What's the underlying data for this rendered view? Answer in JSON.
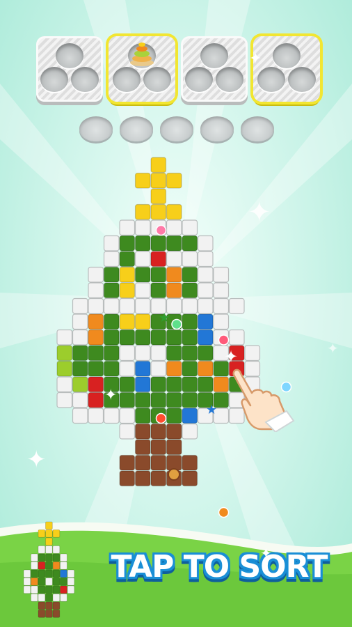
{
  "banner": {
    "text": "TAP TO SORT"
  },
  "colors": {
    "green": "#3e8a1f",
    "green_dark": "#2f6e16",
    "white": "#f2f2f2",
    "yellow": "#f7cf1a",
    "red": "#d82121",
    "blue": "#2277d6",
    "orange": "#f08a1e",
    "lime": "#9ccd2c",
    "brown": "#8a4a2b",
    "accent_blue": "#1a8fd6",
    "bin_highlight": "#f2e631"
  },
  "bins": [
    {
      "highlighted": false,
      "holes": 3,
      "has_stack": false
    },
    {
      "highlighted": true,
      "holes": 3,
      "has_stack": true
    },
    {
      "highlighted": false,
      "holes": 3,
      "has_stack": false
    },
    {
      "highlighted": true,
      "holes": 3,
      "has_stack": false
    }
  ],
  "empty_slots": 5,
  "icons": {
    "hand": "pointing-hand-icon",
    "sparkle": "sparkle-icon",
    "star": "star-icon",
    "button": "button-icon"
  }
}
